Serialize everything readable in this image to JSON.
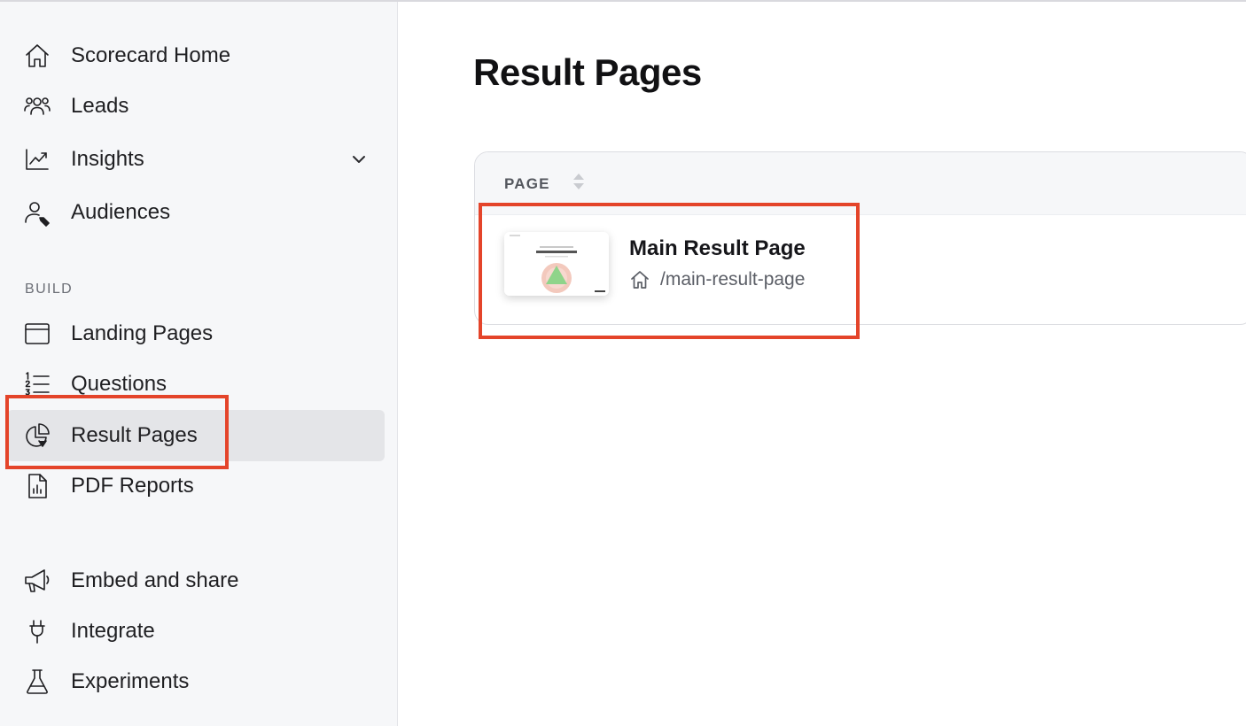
{
  "sidebar": {
    "items": [
      {
        "label": "Scorecard Home",
        "icon": "home-icon"
      },
      {
        "label": "Leads",
        "icon": "users-icon"
      },
      {
        "label": "Insights",
        "icon": "trend-chart-icon",
        "has_chevron": true
      },
      {
        "label": "Audiences",
        "icon": "user-tag-icon"
      }
    ],
    "build_section_label": "BUILD",
    "build_items": [
      {
        "label": "Landing Pages",
        "icon": "browser-window-icon"
      },
      {
        "label": "Questions",
        "icon": "numbered-list-icon"
      },
      {
        "label": "Result Pages",
        "icon": "pie-chart-icon",
        "active": true
      },
      {
        "label": "PDF Reports",
        "icon": "document-chart-icon"
      }
    ],
    "bottom_items": [
      {
        "label": "Embed and share",
        "icon": "megaphone-icon"
      },
      {
        "label": "Integrate",
        "icon": "plug-icon"
      },
      {
        "label": "Experiments",
        "icon": "flask-icon"
      }
    ]
  },
  "main": {
    "title": "Result Pages",
    "table": {
      "column_header": "PAGE",
      "rows": [
        {
          "title": "Main Result Page",
          "path": "/main-result-page",
          "path_icon": "home-icon"
        }
      ]
    }
  },
  "colors": {
    "highlight": "#e4442a",
    "sidebar_bg": "#f6f7f9",
    "active_item_bg": "#e4e5e8"
  }
}
